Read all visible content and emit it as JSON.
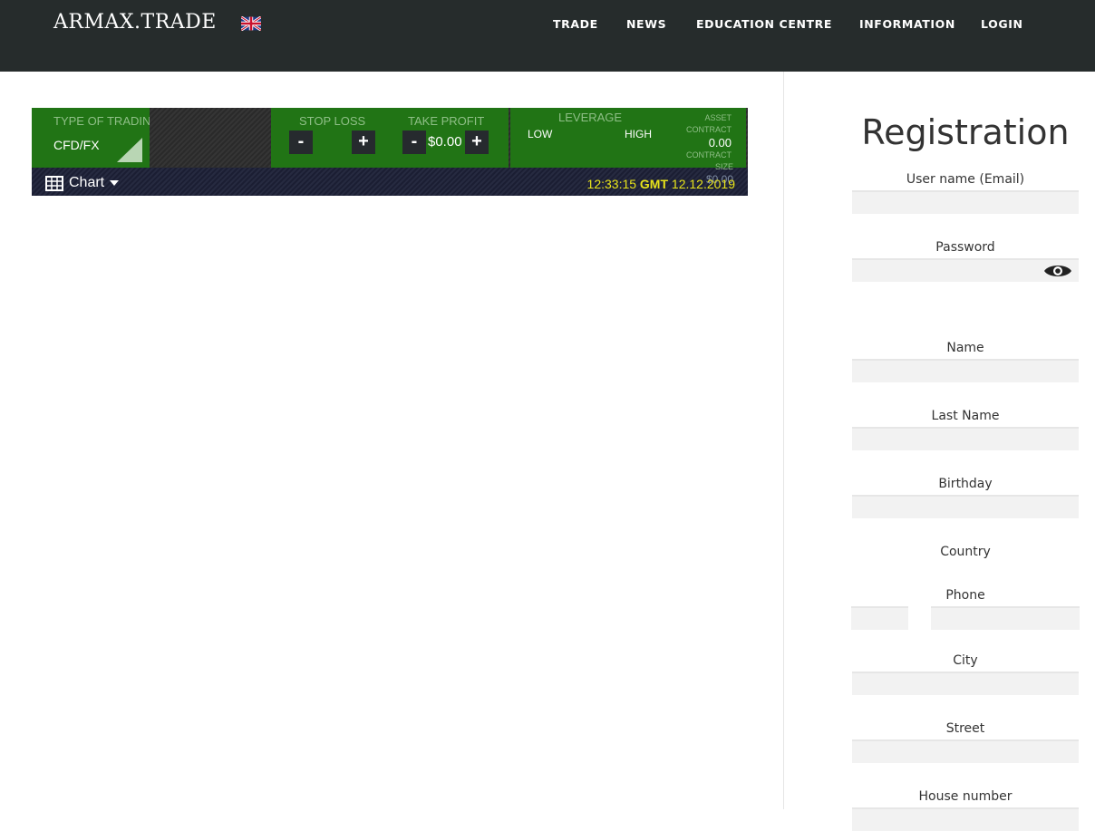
{
  "header": {
    "logo": "ARMAX.TRADE",
    "flag_icon": "uk-flag-icon",
    "nav": [
      "TRADE",
      "NEWS",
      "EDUCATION CENTRE",
      "INFORMATION",
      "LOGIN"
    ]
  },
  "widget": {
    "type_label": "TYPE OF TRADIN",
    "type_value": "CFD/FX",
    "stop_loss_label": "STOP LOSS",
    "take_profit_label": "TAKE PROFIT",
    "take_profit_value": "$0.00",
    "minus": "-",
    "plus": "+",
    "leverage_label": "LEVERAGE",
    "low": "LOW",
    "high": "HIGH",
    "asset": "ASSET",
    "contract": "CONTRACT",
    "contract_value": "0.00",
    "contract2": "CONTRACT",
    "size": "SIZE",
    "size_value": "$0.00",
    "chart_label": "Chart",
    "time": "12:33:15",
    "gmt": "GMT",
    "date": "12.12.2019"
  },
  "registration": {
    "title": "Registration",
    "fields": [
      "User name (Email)",
      "Password",
      "Name",
      "Last Name",
      "Birthday",
      "Country",
      "Phone",
      "City",
      "Street",
      "House number"
    ]
  },
  "colors": {
    "header": "#262c2c",
    "green": "#217415",
    "time": "#e8e41a"
  }
}
